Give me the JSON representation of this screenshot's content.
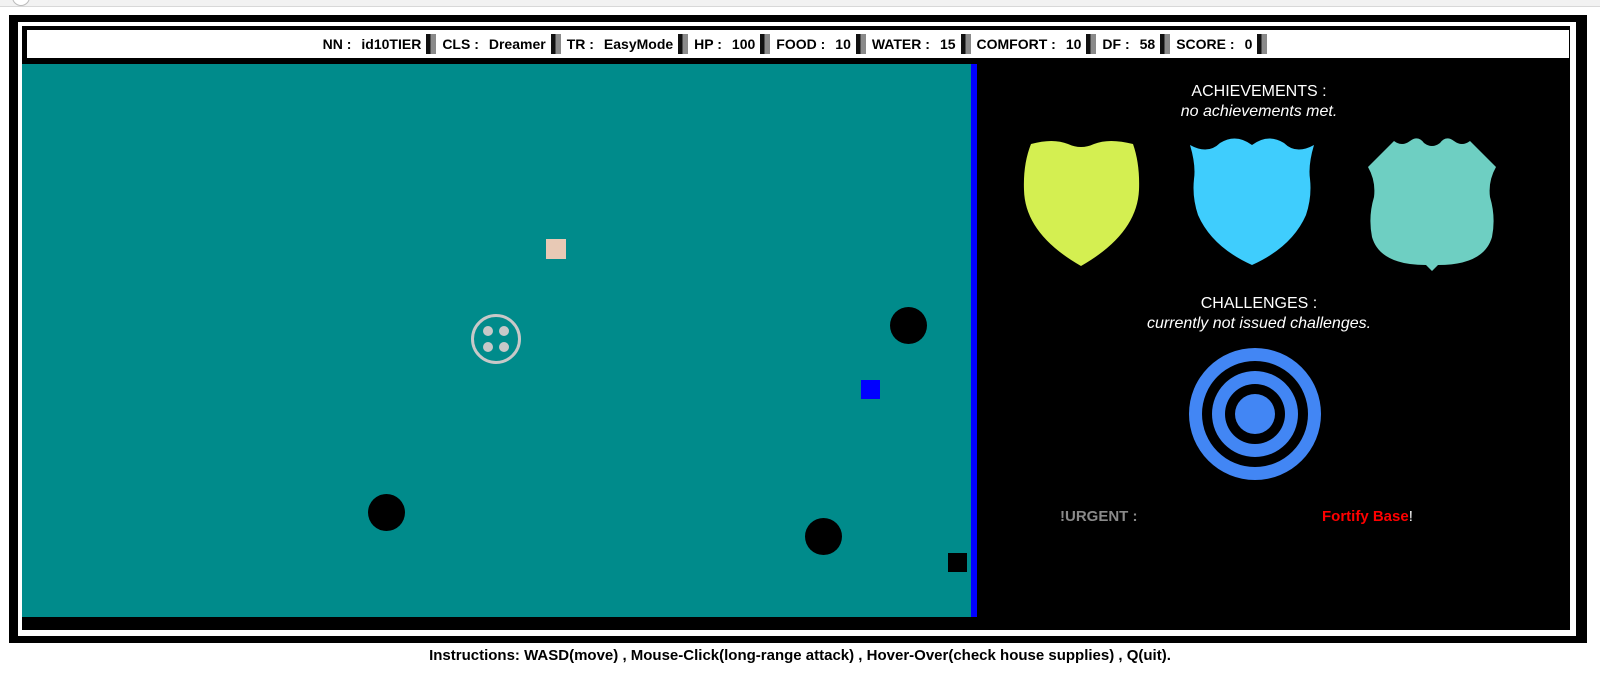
{
  "stats": [
    {
      "label": "NN :",
      "value": "id10TIER"
    },
    {
      "label": "CLS :",
      "value": "Dreamer"
    },
    {
      "label": "TR :",
      "value": "EasyMode"
    },
    {
      "label": "HP :",
      "value": "100"
    },
    {
      "label": "FOOD :",
      "value": "10"
    },
    {
      "label": "WATER :",
      "value": "15"
    },
    {
      "label": "COMFORT :",
      "value": "10"
    },
    {
      "label": "DF :",
      "value": "58"
    },
    {
      "label": "SCORE :",
      "value": "0"
    }
  ],
  "side_panel": {
    "achievements_title": "ACHIEVEMENTS :",
    "achievements_status": "no achievements met.",
    "badges": [
      {
        "icon": "shield-badge-icon",
        "color": "#d4ef51"
      },
      {
        "icon": "shield-badge-icon",
        "color": "#3fcdfd"
      },
      {
        "icon": "shield-badge-icon",
        "color": "#6ecfc2"
      }
    ],
    "challenges_title": "CHALLENGES :",
    "challenges_status": "currently not issued challenges.",
    "target_icon": "target-icon",
    "target_color": "#4286f4",
    "urgent_label": "!URGENT :",
    "urgent_task": "Fortify Base",
    "urgent_suffix": "!"
  },
  "instructions": "Instructions: WASD(move) , Mouse-Click(long-range attack) , Hover-Over(check house supplies) , Q(uit).",
  "colors": {
    "game_background": "#008b8b",
    "divider": "#0000ff",
    "urgent": "#ff0000"
  }
}
